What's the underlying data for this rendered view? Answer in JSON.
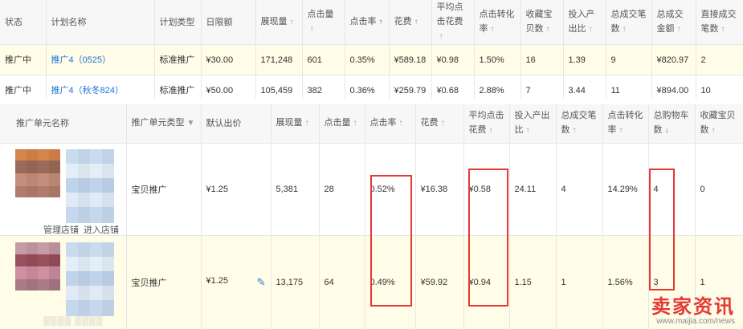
{
  "plan_table": {
    "headers": [
      "状态",
      "计划名称",
      "计划类型",
      "日限额",
      "展现量",
      "点击量",
      "点击率",
      "花费",
      "平均点击花费",
      "点击转化率",
      "收藏宝贝数",
      "投入产出比",
      "总成交笔数",
      "总成交金额",
      "直接成交笔数"
    ],
    "rows": [
      {
        "status": "推广中",
        "name": "推广4（0525）",
        "type": "标准推广",
        "daily_limit": "¥30.00",
        "impressions": "171,248",
        "clicks": "601",
        "ctr": "0.35%",
        "cost": "¥589.18",
        "avg_cpc": "¥0.98",
        "cvr": "1.50%",
        "fav_items": "16",
        "roi": "1.39",
        "total_orders": "9",
        "total_amount": "¥820.97",
        "direct_orders": "2"
      },
      {
        "status": "推广中",
        "name": "推广4（秋冬824）",
        "type": "标准推广",
        "daily_limit": "¥50.00",
        "impressions": "105,459",
        "clicks": "382",
        "ctr": "0.36%",
        "cost": "¥259.79",
        "avg_cpc": "¥0.68",
        "cvr": "2.88%",
        "fav_items": "7",
        "roi": "3.44",
        "total_orders": "11",
        "total_amount": "¥894.00",
        "direct_orders": "10"
      }
    ]
  },
  "unit_table": {
    "headers": [
      "推广单元名称",
      "推广单元类型",
      "默认出价",
      "展现量",
      "点击量",
      "点击率",
      "花费",
      "平均点击花费",
      "投入产出比",
      "总成交笔数",
      "点击转化率",
      "总购物车数",
      "收藏宝贝数"
    ],
    "shop_links": {
      "manage": "管理店铺",
      "enter": "进入店铺"
    },
    "rows": [
      {
        "type": "宝贝推广",
        "bid": "¥1.25",
        "impressions": "5,381",
        "clicks": "28",
        "ctr": "0.52%",
        "cost": "¥16.38",
        "avg_cpc": "¥0.58",
        "roi": "24.11",
        "total_orders": "4",
        "cvr": "14.29%",
        "cart": "4",
        "fav_items": "0"
      },
      {
        "type": "宝贝推广",
        "bid": "¥1.25",
        "impressions": "13,175",
        "clicks": "64",
        "ctr": "0.49%",
        "cost": "¥59.92",
        "avg_cpc": "¥0.94",
        "roi": "1.15",
        "total_orders": "1",
        "cvr": "1.56%",
        "cart": "3",
        "fav_items": "1"
      }
    ]
  },
  "watermark": {
    "main": "卖家资讯",
    "url": "www.maijia.com/news"
  },
  "colors": {
    "accent": "#1e73d8",
    "highlight_row": "#fffde7",
    "annotation_box": "#e53935"
  }
}
